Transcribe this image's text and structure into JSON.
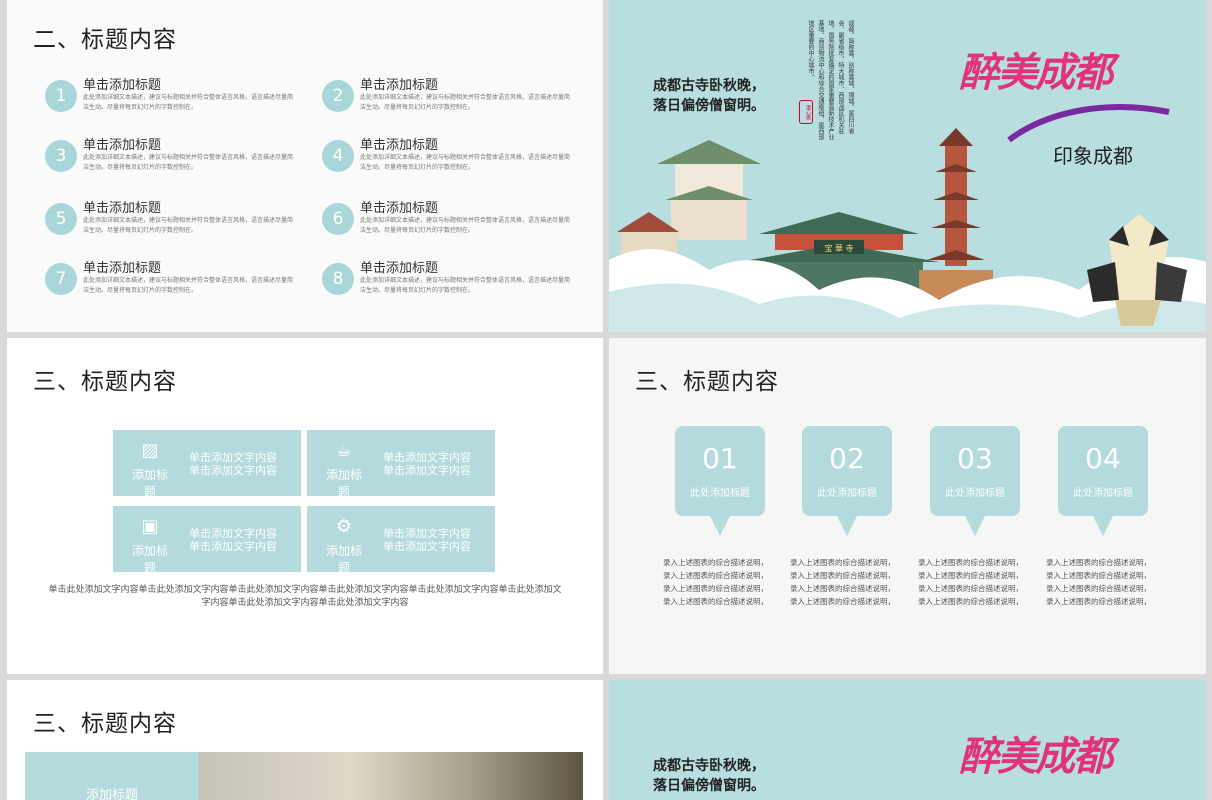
{
  "slide1": {
    "title": "二、标题内容",
    "items": [
      {
        "num": "1",
        "title": "单击添加标题",
        "desc": "此处添加详细文本描述，建议与标题相关并符合整体语言风格，语言描述尽量简洁生动。尽量将每页幻灯片的字数控制在。"
      },
      {
        "num": "2",
        "title": "单击添加标题",
        "desc": "此处添加详细文本描述，建议与标题相关并符合整体语言风格，语言描述尽量简洁生动。尽量将每页幻灯片的字数控制在。"
      },
      {
        "num": "3",
        "title": "单击添加标题",
        "desc": "此处添加详细文本描述，建议与标题相关并符合整体语言风格，语言描述尽量简洁生动。尽量将每页幻灯片的字数控制在。"
      },
      {
        "num": "4",
        "title": "单击添加标题",
        "desc": "此处添加详细文本描述，建议与标题相关并符合整体语言风格，语言描述尽量简洁生动。尽量将每页幻灯片的字数控制在。"
      },
      {
        "num": "5",
        "title": "单击添加标题",
        "desc": "此处添加详细文本描述，建议与标题相关并符合整体语言风格，语言描述尽量简洁生动。尽量将每页幻灯片的字数控制在。"
      },
      {
        "num": "6",
        "title": "单击添加标题",
        "desc": "此处添加详细文本描述，建议与标题相关并符合整体语言风格，语言描述尽量简洁生动。尽量将每页幻灯片的字数控制在。"
      },
      {
        "num": "7",
        "title": "单击添加标题",
        "desc": "此处添加详细文本描述，建议与标题相关并符合整体语言风格，语言描述尽量简洁生动。尽量将每页幻灯片的字数控制在。"
      },
      {
        "num": "8",
        "title": "单击添加标题",
        "desc": "此处添加详细文本描述，建议与标题相关并符合整体语言风格，语言描述尽量简洁生动。尽量将每页幻灯片的字数控制在。"
      }
    ]
  },
  "slide2": {
    "poem_line1": "成都古寺卧秋晚，",
    "poem_line2": "落日偏傍僧窗明。",
    "brush_title": "醉美成都",
    "subtitle": "印象成都",
    "seal": "澄心斋",
    "vertical_cols": [
      "成都，简称蓉，别称蓉城、锦城，",
      "是四川省会、副省级市，",
      "特大城市、西部战区机关驻地，",
      "国务院批复确定的国家重要高新技",
      "术产业基地、商贸物流中心",
      "和综合交通枢纽，是西部地区重",
      "要的中心城市。"
    ]
  },
  "slide3": {
    "title": "三、标题内容",
    "cards": [
      {
        "icon": "image-icon",
        "glyph": "▨",
        "label": "添加标题",
        "text1": "单击添加文字内容",
        "text2": "单击添加文字内容"
      },
      {
        "icon": "coffee-icon",
        "glyph": "☕",
        "label": "添加标题",
        "text1": "单击添加文字内容",
        "text2": "单击添加文字内容"
      },
      {
        "icon": "sofa-icon",
        "glyph": "▣",
        "label": "添加标题",
        "text1": "单击添加文字内容",
        "text2": "单击添加文字内容"
      },
      {
        "icon": "gears-icon",
        "glyph": "⚙",
        "label": "添加标题",
        "text1": "单击添加文字内容",
        "text2": "单击添加文字内容"
      }
    ],
    "footer": "单击此处添加文字内容单击此处添加文字内容单击此处添加文字内容单击此处添加文字内容单击此处添加文字内容单击此处添加文字内容单击此处添加文字内容单击此处添加文字内容"
  },
  "slide4": {
    "title": "三、标题内容",
    "bubbles": [
      {
        "num": "01",
        "label": "此处添加标题",
        "desc": "录入上述图表的综合描述说明，录入上述图表的综合描述说明，录入上述图表的综合描述说明，录入上述图表的综合描述说明，"
      },
      {
        "num": "02",
        "label": "此处添加标题",
        "desc": "录入上述图表的综合描述说明，录入上述图表的综合描述说明，录入上述图表的综合描述说明，录入上述图表的综合描述说明，"
      },
      {
        "num": "03",
        "label": "此处添加标题",
        "desc": "录入上述图表的综合描述说明，录入上述图表的综合描述说明，录入上述图表的综合描述说明，录入上述图表的综合描述说明，"
      },
      {
        "num": "04",
        "label": "此处添加标题",
        "desc": "录入上述图表的综合描述说明，录入上述图表的综合描述说明，录入上述图表的综合描述说明，录入上述图表的综合描述说明，"
      }
    ]
  },
  "slide5": {
    "title": "三、标题内容",
    "band_label": "添加标题"
  },
  "slide6": {
    "poem_line1": "成都古寺卧秋晚，",
    "poem_line2": "落日偏傍僧窗明。",
    "brush_title": "醉美成都"
  },
  "colors": {
    "accent": "#b4dadd",
    "poster_bg": "#b9dee0",
    "brush": "#e0337a"
  }
}
